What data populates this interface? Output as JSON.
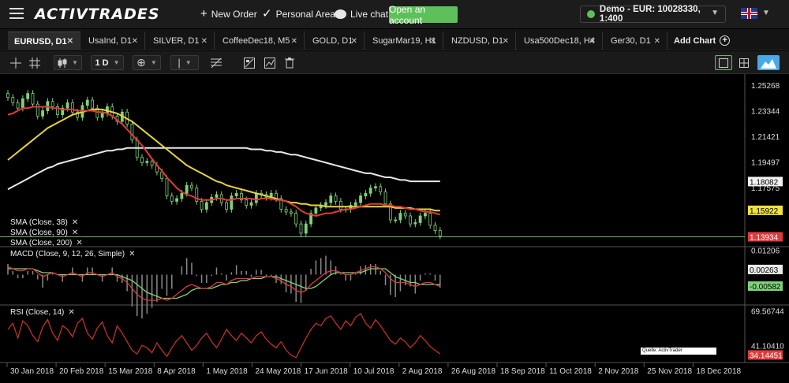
{
  "topbar": {
    "logo": "ACTIVTRADES",
    "new_order": "New Order",
    "personal_area": "Personal Area",
    "live_chat": "Live chat",
    "open_account": "Open an account",
    "account": "Demo - EUR: 10028330, 1:400"
  },
  "tabs": [
    {
      "label": "EURUSD, D1"
    },
    {
      "label": "UsaInd, D1"
    },
    {
      "label": "SILVER, D1"
    },
    {
      "label": "CoffeeDec18, M5"
    },
    {
      "label": "GOLD, D1"
    },
    {
      "label": "SugarMar19, H1"
    },
    {
      "label": "NZDUSD, D1"
    },
    {
      "label": "Usa500Dec18, H4"
    },
    {
      "label": "Ger30, D1"
    }
  ],
  "add_chart": "Add Chart",
  "toolbar": {
    "timeframe": "1 D"
  },
  "indicators": {
    "sma38": "SMA (Close, 38)",
    "sma90": "SMA (Close, 90)",
    "sma200": "SMA (Close, 200)",
    "macd": "MACD (Close, 9, 12, 26, Simple)",
    "rsi": "RSI (Close, 14)"
  },
  "source_note": "Quelle: ActivTrader Handelsplattform",
  "colors": {
    "sma38": "#e03a3a",
    "sma90": "#e8d438",
    "sma200": "#e8e8e8",
    "candle_up": "#7fd27a",
    "macd_line": "#e03a3a",
    "signal_line": "#7fd27a",
    "rsi_line": "#c0302a",
    "accent": "#5ec05a"
  },
  "chart_data": {
    "type": "line",
    "symbol": "EURUSD",
    "price_axis_ticks": [
      1.25268,
      1.23344,
      1.21421,
      1.19497,
      1.17575
    ],
    "price_markers": {
      "sma200": 1.18082,
      "sma90": 1.15922,
      "last_price": 1.13934
    },
    "macd_axis_ticks": [
      0.01206
    ],
    "macd_markers": {
      "signal": 0.00263,
      "macd": -0.00582
    },
    "rsi_axis_ticks": [
      69.56744,
      41.1041
    ],
    "rsi_markers": {
      "rsi": 34.14451
    },
    "x_ticks": [
      "30 Jan 2018",
      "20 Feb 2018",
      "15 Mar 2018",
      "8 Apr 2018",
      "1 May 2018",
      "24 May 2018",
      "17 Jun 2018",
      "10 Jul 2018",
      "2 Aug 2018",
      "26 Aug 2018",
      "18 Sep 2018",
      "11 Oct 2018",
      "2 Nov 2018",
      "25 Nov 2018",
      "18 Dec 2018"
    ],
    "x": [
      0,
      3,
      6,
      9,
      12,
      15,
      18,
      21,
      24,
      27,
      30,
      33,
      36,
      39,
      42,
      45,
      48,
      51,
      54,
      57,
      60,
      63,
      66,
      69,
      72,
      75,
      78,
      81,
      84,
      87,
      90,
      93,
      96,
      99,
      102,
      105,
      108,
      111,
      114,
      117,
      120,
      123,
      126,
      129,
      132,
      135,
      138,
      141,
      144,
      147,
      150,
      153,
      156,
      159,
      162,
      165,
      168,
      171,
      174,
      177,
      180,
      183,
      186,
      189,
      192,
      195,
      198,
      201,
      204,
      207,
      210,
      213,
      216,
      219,
      222,
      225,
      228,
      231,
      234,
      237,
      240,
      243,
      246,
      249,
      252,
      255,
      258,
      261
    ],
    "series": [
      {
        "name": "close",
        "values": [
          1.244,
          1.24,
          1.236,
          1.243,
          1.247,
          1.239,
          1.23,
          1.234,
          1.241,
          1.237,
          1.231,
          1.236,
          1.24,
          1.233,
          1.229,
          1.238,
          1.242,
          1.236,
          1.229,
          1.232,
          1.237,
          1.23,
          1.226,
          1.233,
          1.224,
          1.212,
          1.199,
          1.195,
          1.196,
          1.193,
          1.188,
          1.183,
          1.17,
          1.166,
          1.168,
          1.172,
          1.178,
          1.176,
          1.166,
          1.16,
          1.165,
          1.169,
          1.171,
          1.165,
          1.16,
          1.17,
          1.172,
          1.167,
          1.163,
          1.165,
          1.172,
          1.171,
          1.169,
          1.172,
          1.168,
          1.16,
          1.158,
          1.157,
          1.149,
          1.142,
          1.149,
          1.157,
          1.161,
          1.163,
          1.165,
          1.17,
          1.166,
          1.16,
          1.16,
          1.163,
          1.165,
          1.17,
          1.172,
          1.176,
          1.177,
          1.173,
          1.164,
          1.152,
          1.152,
          1.157,
          1.155,
          1.149,
          1.15,
          1.155,
          1.157,
          1.148,
          1.144,
          1.14
        ]
      },
      {
        "name": "SMA (Close, 38)",
        "values": [
          1.231,
          1.232,
          1.234,
          1.236,
          1.236,
          1.237,
          1.237,
          1.237,
          1.237,
          1.236,
          1.236,
          1.235,
          1.235,
          1.235,
          1.234,
          1.234,
          1.234,
          1.234,
          1.233,
          1.233,
          1.232,
          1.23,
          1.227,
          1.224,
          1.22,
          1.216,
          1.212,
          1.208,
          1.203,
          1.198,
          1.193,
          1.189,
          1.184,
          1.18,
          1.176,
          1.173,
          1.171,
          1.17,
          1.168,
          1.167,
          1.167,
          1.167,
          1.168,
          1.168,
          1.167,
          1.167,
          1.168,
          1.168,
          1.168,
          1.168,
          1.167,
          1.168,
          1.168,
          1.168,
          1.167,
          1.167,
          1.166,
          1.164,
          1.162,
          1.159,
          1.157,
          1.156,
          1.155,
          1.156,
          1.157,
          1.157,
          1.158,
          1.159,
          1.16,
          1.16,
          1.161,
          1.162,
          1.163,
          1.164,
          1.164,
          1.164,
          1.163,
          1.163,
          1.162,
          1.162,
          1.161,
          1.16,
          1.16,
          1.159,
          1.158,
          1.158,
          1.157,
          1.156
        ]
      },
      {
        "name": "SMA (Close, 90)",
        "values": [
          1.197,
          1.2,
          1.203,
          1.206,
          1.209,
          1.212,
          1.215,
          1.218,
          1.221,
          1.223,
          1.225,
          1.227,
          1.229,
          1.231,
          1.232,
          1.233,
          1.234,
          1.235,
          1.235,
          1.235,
          1.234,
          1.233,
          1.232,
          1.23,
          1.228,
          1.226,
          1.223,
          1.22,
          1.217,
          1.214,
          1.211,
          1.208,
          1.205,
          1.202,
          1.199,
          1.196,
          1.193,
          1.191,
          1.189,
          1.187,
          1.185,
          1.183,
          1.181,
          1.18,
          1.178,
          1.177,
          1.176,
          1.175,
          1.174,
          1.173,
          1.172,
          1.171,
          1.17,
          1.169,
          1.168,
          1.167,
          1.166,
          1.165,
          1.165,
          1.164,
          1.164,
          1.163,
          1.163,
          1.163,
          1.162,
          1.162,
          1.162,
          1.162,
          1.162,
          1.162,
          1.162,
          1.162,
          1.162,
          1.162,
          1.162,
          1.162,
          1.162,
          1.162,
          1.161,
          1.161,
          1.161,
          1.161,
          1.16,
          1.16,
          1.16,
          1.16,
          1.159,
          1.159
        ]
      },
      {
        "name": "SMA (Close, 200)",
        "values": [
          1.175,
          1.177,
          1.179,
          1.181,
          1.183,
          1.185,
          1.187,
          1.189,
          1.191,
          1.192,
          1.194,
          1.195,
          1.196,
          1.197,
          1.198,
          1.199,
          1.2,
          1.201,
          1.202,
          1.203,
          1.204,
          1.204,
          1.205,
          1.205,
          1.206,
          1.206,
          1.206,
          1.206,
          1.206,
          1.206,
          1.206,
          1.206,
          1.206,
          1.206,
          1.206,
          1.206,
          1.206,
          1.206,
          1.206,
          1.206,
          1.206,
          1.206,
          1.206,
          1.206,
          1.206,
          1.206,
          1.206,
          1.206,
          1.206,
          1.205,
          1.205,
          1.205,
          1.204,
          1.204,
          1.203,
          1.203,
          1.202,
          1.201,
          1.201,
          1.2,
          1.199,
          1.198,
          1.197,
          1.196,
          1.195,
          1.194,
          1.193,
          1.192,
          1.191,
          1.19,
          1.189,
          1.188,
          1.187,
          1.187,
          1.186,
          1.185,
          1.184,
          1.184,
          1.183,
          1.182,
          1.182,
          1.181,
          1.181,
          1.181,
          1.181,
          1.181,
          1.181,
          1.181
        ]
      },
      {
        "name": "macd",
        "values": [
          0.004,
          0.003,
          0.002,
          0.002,
          0.003,
          0.003,
          0.001,
          -0.001,
          0.0,
          0.001,
          0.0,
          -0.001,
          0.0,
          0.001,
          0.0,
          -0.001,
          0.001,
          0.001,
          0.0,
          -0.001,
          0.0,
          0.001,
          -0.001,
          -0.002,
          -0.004,
          -0.007,
          -0.01,
          -0.012,
          -0.013,
          -0.013,
          -0.013,
          -0.012,
          -0.013,
          -0.012,
          -0.01,
          -0.008,
          -0.006,
          -0.005,
          -0.006,
          -0.007,
          -0.007,
          -0.006,
          -0.004,
          -0.004,
          -0.005,
          -0.003,
          -0.002,
          -0.002,
          -0.002,
          -0.002,
          -0.001,
          -0.001,
          -0.001,
          -0.001,
          -0.002,
          -0.003,
          -0.005,
          -0.006,
          -0.008,
          -0.009,
          -0.008,
          -0.005,
          -0.003,
          -0.001,
          0.001,
          0.002,
          0.002,
          0.001,
          0.0,
          0.0,
          0.001,
          0.002,
          0.003,
          0.004,
          0.004,
          0.003,
          0.001,
          -0.002,
          -0.004,
          -0.004,
          -0.004,
          -0.005,
          -0.006,
          -0.005,
          -0.004,
          -0.004,
          -0.005,
          -0.006
        ]
      },
      {
        "name": "signal",
        "values": [
          0.003,
          0.003,
          0.003,
          0.003,
          0.003,
          0.003,
          0.002,
          0.001,
          0.001,
          0.001,
          0.0,
          0.0,
          0.0,
          0.0,
          0.0,
          0.0,
          0.0,
          0.0,
          0.0,
          0.0,
          0.0,
          0.0,
          0.0,
          -0.001,
          -0.002,
          -0.003,
          -0.005,
          -0.007,
          -0.009,
          -0.01,
          -0.011,
          -0.012,
          -0.012,
          -0.012,
          -0.012,
          -0.011,
          -0.01,
          -0.008,
          -0.007,
          -0.007,
          -0.007,
          -0.007,
          -0.006,
          -0.005,
          -0.005,
          -0.004,
          -0.004,
          -0.003,
          -0.003,
          -0.002,
          -0.002,
          -0.002,
          -0.001,
          -0.001,
          -0.001,
          -0.002,
          -0.003,
          -0.004,
          -0.005,
          -0.006,
          -0.007,
          -0.007,
          -0.006,
          -0.004,
          -0.002,
          0.0,
          0.001,
          0.001,
          0.001,
          0.001,
          0.001,
          0.001,
          0.002,
          0.003,
          0.003,
          0.003,
          0.003,
          0.001,
          -0.001,
          -0.002,
          -0.003,
          -0.004,
          -0.004,
          -0.005,
          -0.005,
          -0.005,
          -0.005,
          -0.005
        ]
      },
      {
        "name": "rsi",
        "values": [
          55,
          60,
          48,
          62,
          58,
          50,
          45,
          57,
          63,
          52,
          46,
          58,
          55,
          49,
          60,
          64,
          52,
          47,
          56,
          61,
          50,
          44,
          58,
          52,
          45,
          38,
          35,
          42,
          40,
          36,
          44,
          38,
          33,
          40,
          46,
          50,
          44,
          38,
          42,
          48,
          52,
          45,
          40,
          47,
          55,
          50,
          46,
          52,
          48,
          44,
          50,
          53,
          47,
          43,
          40,
          45,
          38,
          34,
          32,
          40,
          48,
          55,
          60,
          58,
          64,
          66,
          60,
          55,
          62,
          58,
          65,
          68,
          60,
          56,
          63,
          58,
          52,
          46,
          43,
          48,
          45,
          40,
          44,
          50,
          46,
          41,
          38,
          35
        ]
      }
    ]
  }
}
